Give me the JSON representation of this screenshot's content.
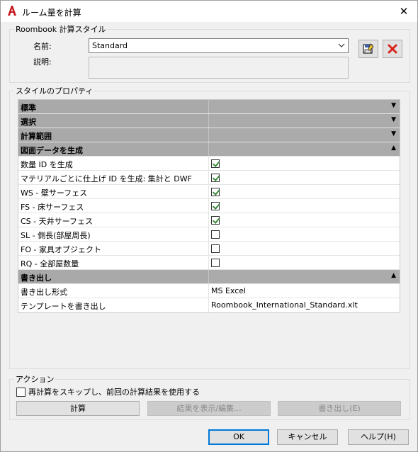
{
  "window": {
    "title": "ルーム量を計算",
    "close_glyph": "✕"
  },
  "style_group": {
    "legend": "Roombook 計算スタイル",
    "name_label": "名前:",
    "name_value": "Standard",
    "desc_label": "説明:",
    "desc_value": ""
  },
  "props_group": {
    "legend": "スタイルのプロパティ"
  },
  "grid": {
    "categories": {
      "standard": "標準",
      "selection": "選択",
      "calc_range": "計算範囲",
      "generate": "図面データを生成",
      "export": "書き出し"
    },
    "generate_rows": [
      {
        "label": "数量 ID を生成",
        "checked": true
      },
      {
        "label": "マテリアルごとに仕上げ ID を生成: 集計と DWF",
        "checked": true
      },
      {
        "label": "WS - 壁サーフェス",
        "checked": true
      },
      {
        "label": "FS - 床サーフェス",
        "checked": true
      },
      {
        "label": "CS - 天井サーフェス",
        "checked": true
      },
      {
        "label": "SL - 側長(部屋周長)",
        "checked": false
      },
      {
        "label": "FO - 家具オブジェクト",
        "checked": false
      },
      {
        "label": "RQ - 全部屋数量",
        "checked": false
      }
    ],
    "export_rows": [
      {
        "label": "書き出し形式",
        "value": "MS Excel"
      },
      {
        "label": "テンプレートを書き出し",
        "value": "Roombook_International_Standard.xlt"
      }
    ]
  },
  "actions_group": {
    "legend": "アクション",
    "skip_checkbox_label": "再計算をスキップし、前回の計算結果を使用する",
    "calc_button": "計算",
    "show_edit_button": "結果を表示/編集...",
    "export_button": "書き出し(E)"
  },
  "footer": {
    "ok": "OK",
    "cancel": "キャンセル",
    "help": "ヘルプ(H)"
  },
  "colors": {
    "app_icon_red": "#c4161c",
    "delete_red": "#d9261c",
    "save_blue": "#3b5ea8"
  }
}
